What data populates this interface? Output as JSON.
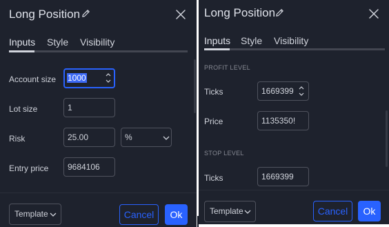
{
  "left": {
    "title": "Long Position",
    "tabs": [
      {
        "label": "Inputs",
        "active": true
      },
      {
        "label": "Style",
        "active": false
      },
      {
        "label": "Visibility",
        "active": false
      }
    ],
    "fields": {
      "account_size": {
        "label": "Account size",
        "value": "1000"
      },
      "lot_size": {
        "label": "Lot size",
        "value": "1"
      },
      "risk": {
        "label": "Risk",
        "value": "25.00",
        "unit": "%"
      },
      "entry_price": {
        "label": "Entry price",
        "value": "9684106"
      }
    },
    "footer": {
      "template_label": "Template",
      "cancel_label": "Cancel",
      "ok_label": "Ok"
    }
  },
  "right": {
    "title": "Long Position",
    "tabs": [
      {
        "label": "Inputs",
        "active": true
      },
      {
        "label": "Style",
        "active": false
      },
      {
        "label": "Visibility",
        "active": false
      }
    ],
    "profit_level": {
      "heading": "PROFIT LEVEL",
      "ticks_label": "Ticks",
      "ticks_value": "1669399",
      "price_label": "Price",
      "price_value": "1135350!"
    },
    "stop_level": {
      "heading": "STOP LEVEL",
      "ticks_label": "Ticks",
      "ticks_value": "1669399"
    },
    "footer": {
      "template_label": "Template",
      "cancel_label": "Cancel",
      "ok_label": "Ok"
    }
  },
  "colors": {
    "background": "#1e222d",
    "accent": "#2962ff",
    "text": "#d1d4dc",
    "border": "#50535e"
  },
  "icons": [
    "pencil-icon",
    "close-icon",
    "stepper-icon",
    "chevron-down-icon"
  ]
}
